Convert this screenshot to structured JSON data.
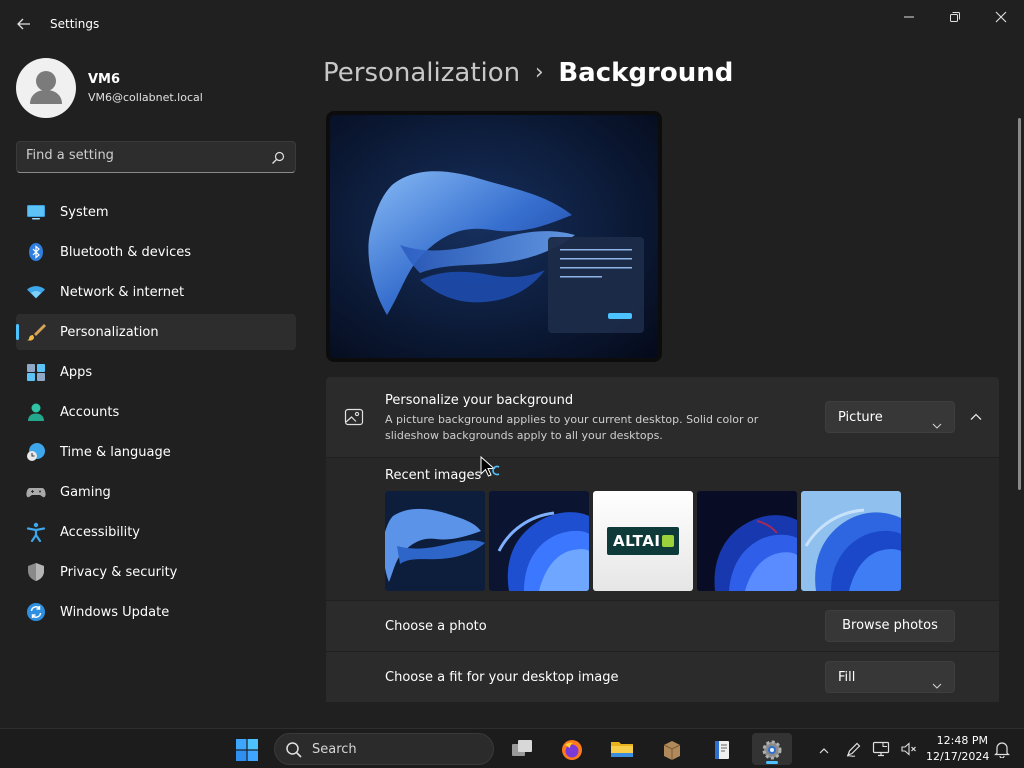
{
  "window": {
    "title": "Settings",
    "back_icon": "arrow-left-icon",
    "controls": [
      "minimize-icon",
      "restore-icon",
      "close-icon"
    ]
  },
  "profile": {
    "name": "VM6",
    "email": "VM6@collabnet.local"
  },
  "search": {
    "placeholder": "Find a setting",
    "icon": "search-icon"
  },
  "nav": {
    "items": [
      {
        "label": "System",
        "icon": "system-monitor-icon",
        "selected": false
      },
      {
        "label": "Bluetooth & devices",
        "icon": "bluetooth-icon",
        "selected": false
      },
      {
        "label": "Network & internet",
        "icon": "wifi-icon",
        "selected": false
      },
      {
        "label": "Personalization",
        "icon": "paintbrush-icon",
        "selected": true
      },
      {
        "label": "Apps",
        "icon": "apps-icon",
        "selected": false
      },
      {
        "label": "Accounts",
        "icon": "person-icon",
        "selected": false
      },
      {
        "label": "Time & language",
        "icon": "globe-clock-icon",
        "selected": false
      },
      {
        "label": "Gaming",
        "icon": "gamepad-icon",
        "selected": false
      },
      {
        "label": "Accessibility",
        "icon": "accessibility-icon",
        "selected": false
      },
      {
        "label": "Privacy & security",
        "icon": "shield-icon",
        "selected": false
      },
      {
        "label": "Windows Update",
        "icon": "update-sync-icon",
        "selected": false
      }
    ]
  },
  "breadcrumb": {
    "parent": "Personalization",
    "separator": "›",
    "current": "Background"
  },
  "background": {
    "title": "Personalize your background",
    "description": "A picture background applies to your current desktop. Solid color or slideshow backgrounds apply to all your desktops.",
    "type_value": "Picture",
    "icon": "image-icon",
    "recent_label": "Recent images",
    "recent_images": [
      "bloom-glow-image",
      "bloom-blue-image",
      "altai-logo-image",
      "bloom-dark-image",
      "bloom-light-image"
    ],
    "altai_logo_text": "ALTAI",
    "choose_photo_label": "Choose a photo",
    "browse_label": "Browse photos",
    "fit_label": "Choose a fit for your desktop image",
    "fit_value": "Fill"
  },
  "taskbar": {
    "search_label": "Search",
    "time": "12:48 PM",
    "date": "12/17/2024",
    "accent": "#4cc2ff"
  },
  "colors": {
    "accent": "#4cc2ff",
    "background": "#202020",
    "card": "#2b2b2b"
  }
}
